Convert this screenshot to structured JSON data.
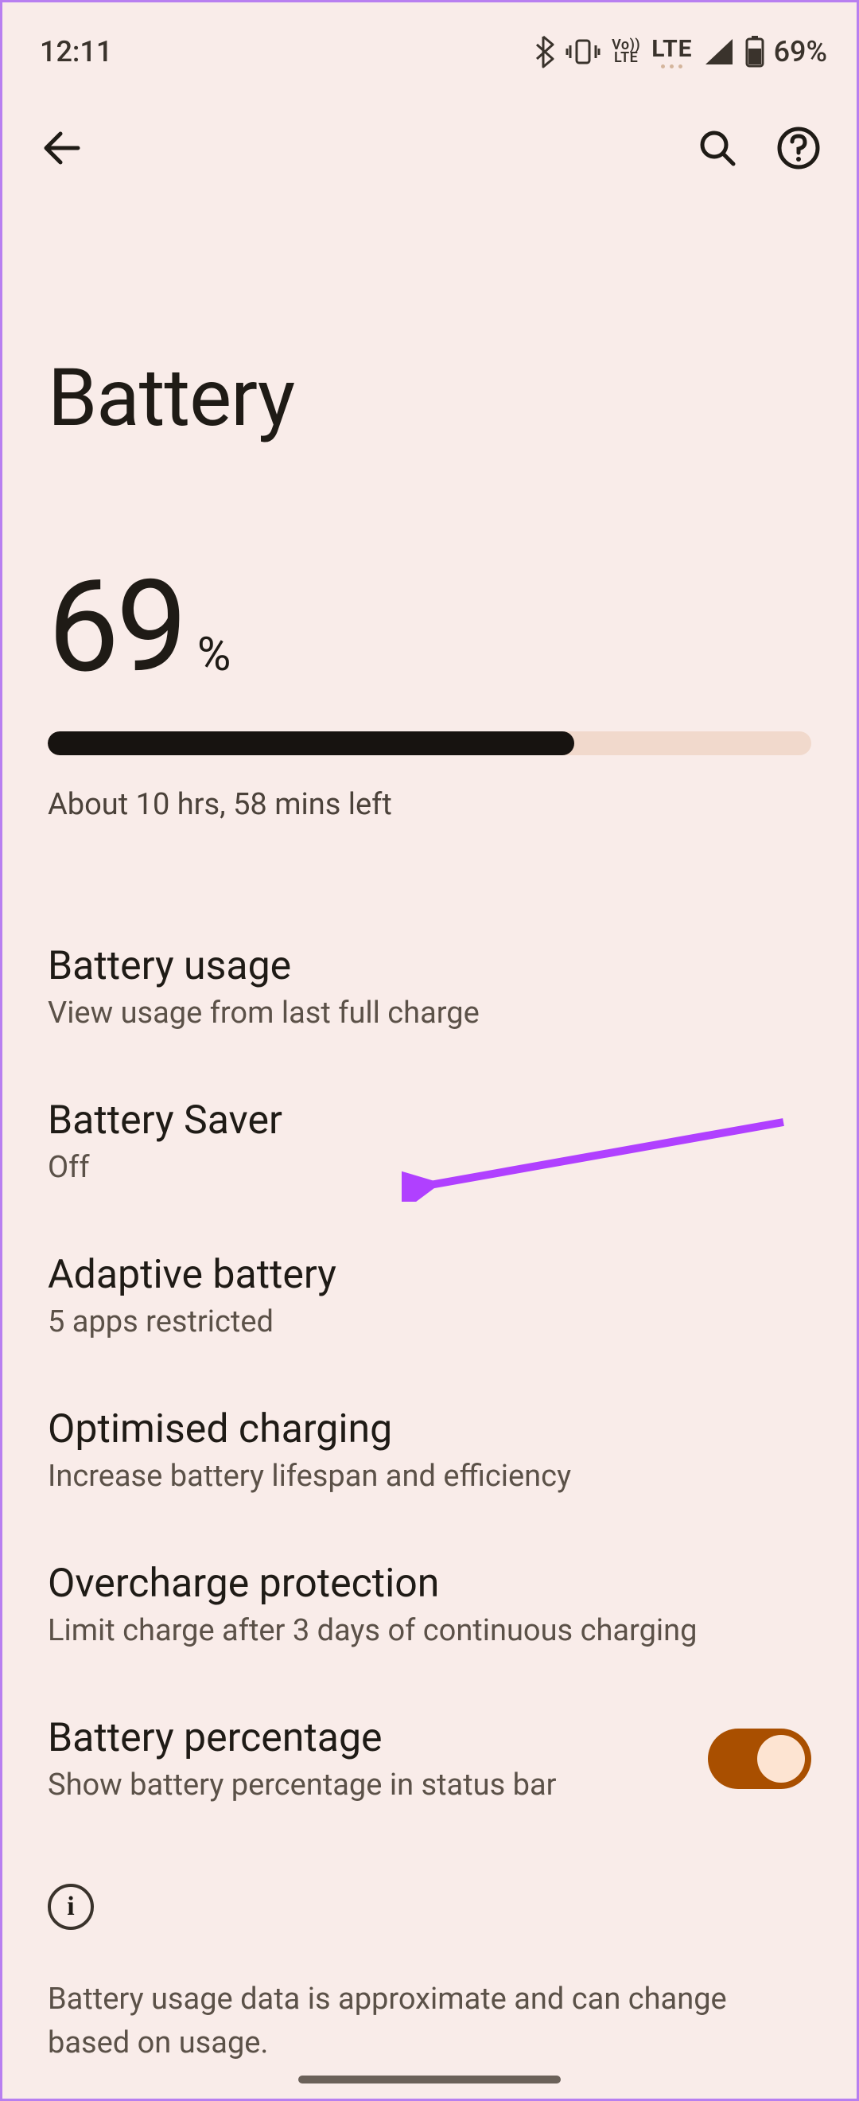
{
  "status": {
    "time": "12:11",
    "battery_pct": "69%"
  },
  "page": {
    "title": "Battery"
  },
  "hero": {
    "value": "69",
    "pct_symbol": "%",
    "progress": 69,
    "estimate": "About 10 hrs, 58 mins left"
  },
  "items": [
    {
      "title": "Battery usage",
      "sub": "View usage from last full charge"
    },
    {
      "title": "Battery Saver",
      "sub": "Off"
    },
    {
      "title": "Adaptive battery",
      "sub": "5 apps restricted"
    },
    {
      "title": "Optimised charging",
      "sub": "Increase battery lifespan and efficiency"
    },
    {
      "title": "Overcharge protection",
      "sub": "Limit charge after 3 days of continuous charging"
    },
    {
      "title": "Battery percentage",
      "sub": "Show battery percentage in status bar"
    }
  ],
  "info": {
    "text": "Battery usage data is approximate and can change based on usage."
  }
}
